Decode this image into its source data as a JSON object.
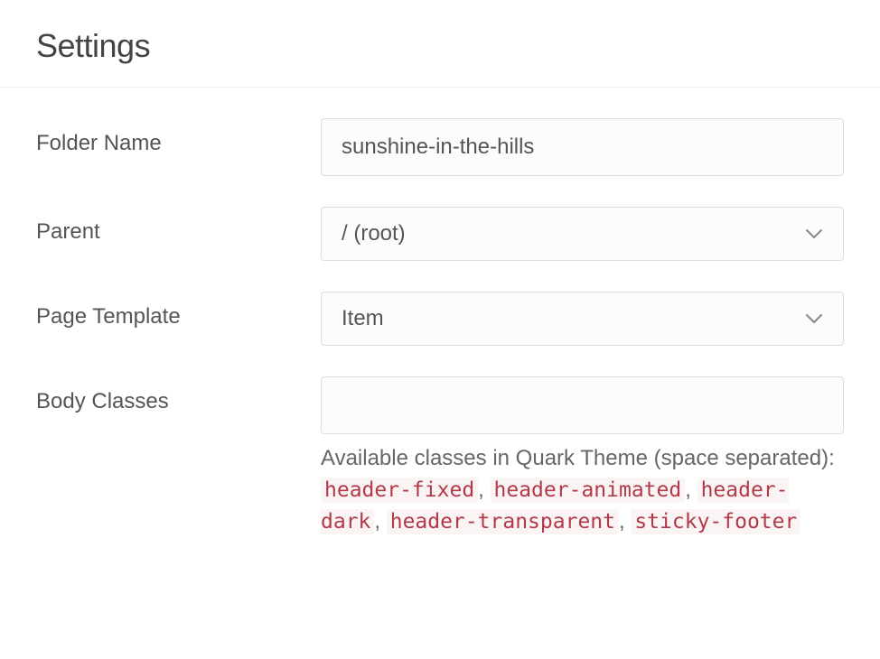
{
  "header": {
    "title": "Settings"
  },
  "form": {
    "folderName": {
      "label": "Folder Name",
      "value": "sunshine-in-the-hills"
    },
    "parent": {
      "label": "Parent",
      "value": "/ (root)"
    },
    "pageTemplate": {
      "label": "Page Template",
      "value": "Item"
    },
    "bodyClasses": {
      "label": "Body Classes",
      "value": "",
      "helpIntro": "Available classes in Quark Theme (space separated):",
      "classes": [
        "header-fixed",
        "header-animated",
        "header-dark",
        "header-transparent",
        "sticky-footer"
      ]
    }
  }
}
